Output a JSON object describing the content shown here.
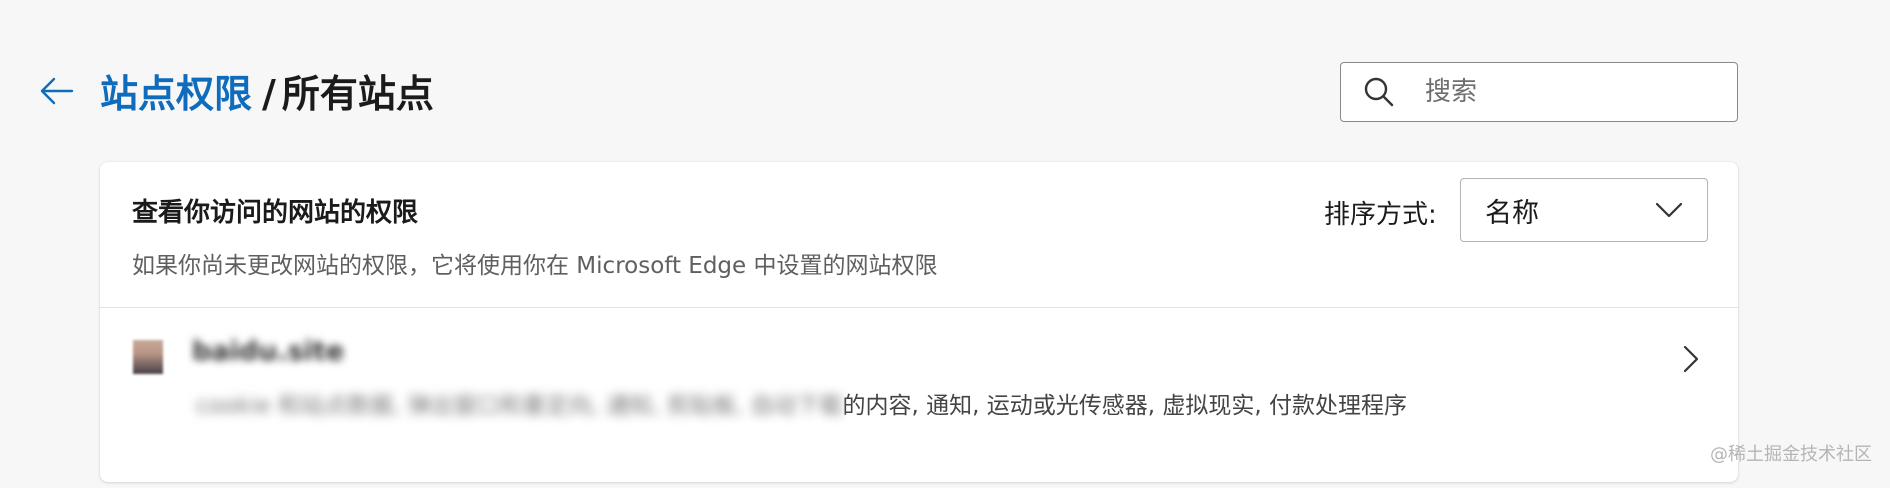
{
  "header": {
    "breadcrumb_link": "站点权限",
    "separator": "/",
    "current_page": "所有站点"
  },
  "search": {
    "placeholder": "搜索"
  },
  "panel": {
    "title": "查看你访问的网站的权限",
    "description": "如果你尚未更改网站的权限，它将使用你在 Microsoft Edge 中设置的网站权限",
    "sort_label": "排序方式:",
    "sort_value": "名称"
  },
  "sites": [
    {
      "name": "baidu.site",
      "permissions_obscured": "cookie 和站点数据, 弹出窗口和重定向, 通知, 剪贴板, 自动下载",
      "permissions_visible": "的内容, 通知, 运动或光传感器, 虚拟现实, 付款处理程序"
    }
  ],
  "watermark": "@稀土掘金技术社区",
  "colors": {
    "accent": "#0f6cbd",
    "background": "#f7f7f7",
    "card": "#ffffff"
  },
  "icons": {
    "back": "arrow-left-icon",
    "search": "search-icon",
    "dropdown": "chevron-down-icon",
    "row": "chevron-right-icon"
  }
}
